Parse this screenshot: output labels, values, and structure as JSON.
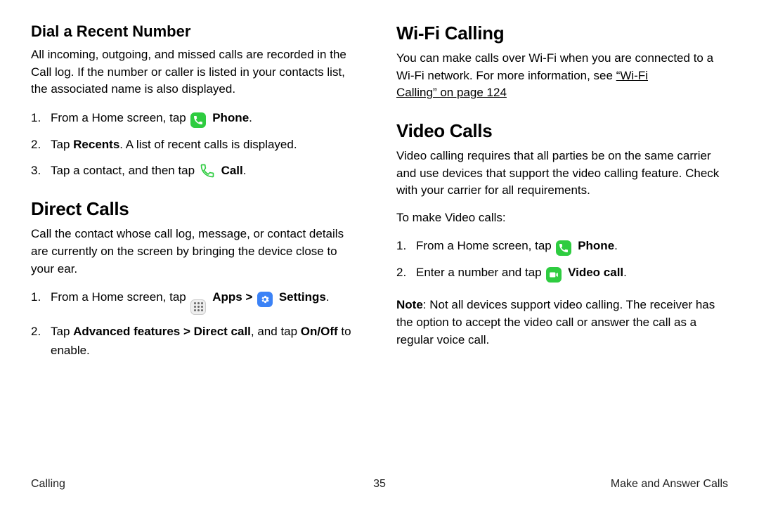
{
  "left": {
    "dial": {
      "heading": "Dial a Recent Number",
      "intro": "All incoming, outgoing, and missed calls are recorded in the Call log. If the number or caller is listed in your contacts list, the associated name is also displayed.",
      "steps": {
        "s1a": "From a Home screen, tap ",
        "s1b": "Phone",
        "s1c": ".",
        "s2a": "Tap ",
        "s2b": "Recents",
        "s2c": ". A list of recent calls is displayed.",
        "s3a": "Tap a contact, and then tap ",
        "s3b": "Call",
        "s3c": "."
      }
    },
    "direct": {
      "heading": "Direct Calls",
      "intro": "Call the contact whose call log, message, or contact details are currently on the screen by bringing the device close to your ear.",
      "steps": {
        "s1a": "From a Home screen, tap ",
        "s1b": "Apps",
        "s1chev": " > ",
        "s1c": "Settings",
        "s1d": ".",
        "s2a": "Tap ",
        "s2b": "Advanced features",
        "s2chev": " > ",
        "s2c": "Direct call",
        "s2d": ", and tap ",
        "s2e": "On/Off",
        "s2f": " to enable."
      }
    }
  },
  "right": {
    "wifi": {
      "heading": "Wi-Fi Calling",
      "introA": "You can make calls over Wi-Fi when you are connected to a Wi-Fi network. For more information, see ",
      "linkA": "“Wi-Fi ",
      "linkB": "Calling” on page 124"
    },
    "video": {
      "heading": "Video Calls",
      "intro": "Video calling requires that all parties be on the same carrier and use devices that support the video calling feature. Check with your carrier for all requirements.",
      "lead": "To make Video calls:",
      "steps": {
        "s1a": "From a Home screen, tap ",
        "s1b": "Phone",
        "s1c": ".",
        "s2a": "Enter a number and tap ",
        "s2b": "Video call",
        "s2c": "."
      },
      "noteLabel": "Note",
      "note": ": Not all devices support video calling. The receiver has the option to accept the video call or answer the call as a regular voice call."
    }
  },
  "footer": {
    "left": "Calling",
    "page": "35",
    "right": "Make and Answer Calls"
  }
}
